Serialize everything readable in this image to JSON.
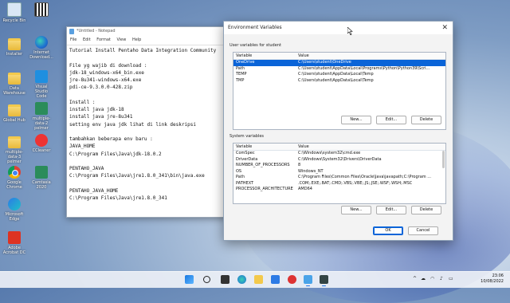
{
  "desktop": {
    "icons": [
      {
        "label": "Recycle Bin",
        "icon": "recycle-bin-icon"
      },
      {
        "label": "",
        "icon": "qr-code-icon"
      },
      {
        "label": "Installer",
        "icon": "folder-icon"
      },
      {
        "label": "Internet Download...",
        "icon": "edge-icon"
      },
      {
        "label": "Data Warehouse",
        "icon": "folder-icon"
      },
      {
        "label": "Visual Studio Code",
        "icon": "vscode-icon"
      },
      {
        "label": "Global Hub",
        "icon": "folder-icon"
      },
      {
        "label": "multiple-data-2 pelmer",
        "icon": "pentaho-icon"
      },
      {
        "label": "multiple-data-3 pelmer",
        "icon": "folder-icon"
      },
      {
        "label": "CCleaner",
        "icon": "ccleaner-icon"
      },
      {
        "label": "Google Chrome",
        "icon": "chrome-icon"
      },
      {
        "label": "Camtasia 2020",
        "icon": "pentaho-icon"
      },
      {
        "label": "Microsoft Edge",
        "icon": "edge-icon"
      },
      {
        "label": "Adobe Acrobat DC",
        "icon": "adobe-icon"
      }
    ]
  },
  "notepad": {
    "title": "*Untitled - Notepad",
    "menu": [
      "File",
      "Edit",
      "Format",
      "View",
      "Help"
    ],
    "lines": [
      "Tutorial Install Pentaho Data Integration Community",
      "",
      "File yg wajib di download :",
      "jdk-18_windows-x64_bin.exe",
      "jre-8u341-windows-x64.exe",
      "pdi-ce-9.3.0.0-428.zip",
      "",
      "Install :",
      "install java jdk-18",
      "install java jre-8u341",
      "setting env java jdk lihat di link deskripsi",
      "",
      "tambahkan beberapa env baru :",
      "JAVA_HOME",
      "C:\\Program Files\\Java\\jdk-18.0.2",
      "",
      "PENTAHO_JAVA",
      "C:\\Program Files\\Java\\jre1.8.0_341\\bin\\java.exe",
      "",
      "PENTAHO_JAVA_HOME",
      "C:\\Program Files\\Java\\jre1.8.0_341"
    ]
  },
  "env_dialog": {
    "title": "Environment Variables",
    "user_section_label": "User variables for student",
    "system_section_label": "System variables",
    "columns": [
      "Variable",
      "Value"
    ],
    "user_vars": [
      {
        "name": "OneDrive",
        "value": "C:\\Users\\student\\OneDrive"
      },
      {
        "name": "Path",
        "value": "C:\\Users\\student\\AppData\\Local\\Programs\\Python\\Python39\\Scri..."
      },
      {
        "name": "TEMP",
        "value": "C:\\Users\\student\\AppData\\Local\\Temp"
      },
      {
        "name": "TMP",
        "value": "C:\\Users\\student\\AppData\\Local\\Temp"
      }
    ],
    "system_vars": [
      {
        "name": "ComSpec",
        "value": "C:\\Windows\\system32\\cmd.exe"
      },
      {
        "name": "DriverData",
        "value": "C:\\Windows\\System32\\Drivers\\DriverData"
      },
      {
        "name": "NUMBER_OF_PROCESSORS",
        "value": "8"
      },
      {
        "name": "OS",
        "value": "Windows_NT"
      },
      {
        "name": "Path",
        "value": "C:\\Program Files\\Common Files\\Oracle\\Java\\javapath;C:\\Program ..."
      },
      {
        "name": "PATHEXT",
        "value": ".COM;.EXE;.BAT;.CMD;.VBS;.VBE;.JS;.JSE;.WSF;.WSH;.MSC"
      },
      {
        "name": "PROCESSOR_ARCHITECTURE",
        "value": "AMD64"
      }
    ],
    "buttons": {
      "new": "New...",
      "edit": "Edit...",
      "delete": "Delete",
      "ok": "OK",
      "cancel": "Cancel"
    },
    "selected_user_row": 0
  },
  "taskbar": {
    "time": "23:06",
    "date": "10/08/2022",
    "tray_caret": "^",
    "colors": {
      "accent": "#1a73e8"
    }
  }
}
